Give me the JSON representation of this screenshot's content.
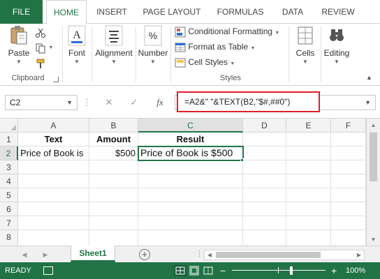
{
  "ribbon_tabs": [
    "FILE",
    "HOME",
    "INSERT",
    "PAGE LAYOUT",
    "FORMULAS",
    "DATA",
    "REVIEW"
  ],
  "active_tab": "HOME",
  "clipboard": {
    "paste": "Paste",
    "group_label": "Clipboard"
  },
  "font": {
    "label": "Font"
  },
  "alignment": {
    "label": "Alignment"
  },
  "number": {
    "label": "Number"
  },
  "styles": {
    "conditional_formatting": "Conditional Formatting",
    "format_as_table": "Format as Table",
    "cell_styles": "Cell Styles",
    "group_label": "Styles"
  },
  "cells": {
    "label": "Cells"
  },
  "editing": {
    "label": "Editing"
  },
  "formula_bar": {
    "name_box": "C2",
    "fx": "fx",
    "formula": "=A2&\" \"&TEXT(B2,\"$#,##0\")"
  },
  "grid": {
    "columns": [
      "A",
      "B",
      "C",
      "D",
      "E",
      "F"
    ],
    "selected_column": "C",
    "rows": [
      "1",
      "2",
      "3",
      "4",
      "5",
      "6",
      "7",
      "8"
    ],
    "selected_row": "2",
    "header_row": {
      "a": "Text",
      "b": "Amount",
      "c": "Result"
    },
    "data_row": {
      "a": "Price of Book is",
      "b": "$500",
      "c": "Price of Book is $500"
    }
  },
  "sheet": {
    "tab_name": "Sheet1"
  },
  "status": {
    "text": "READY",
    "zoom": "100%",
    "zoom_level_percent": 100
  },
  "colors": {
    "excel_green": "#217346",
    "highlight_red": "#e01e2d"
  }
}
